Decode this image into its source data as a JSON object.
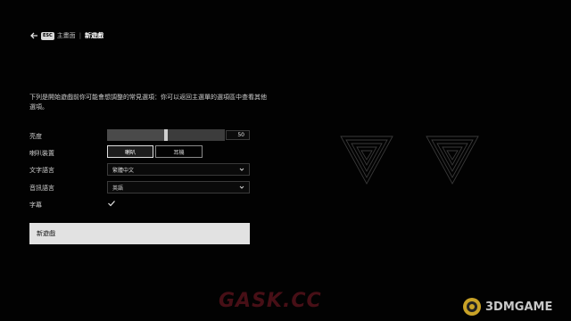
{
  "header": {
    "esc_label": "ESC",
    "breadcrumb_home": "主畫面",
    "breadcrumb_separator": "|",
    "breadcrumb_current": "新遊戲"
  },
  "intro_text": "下列是開始遊戲前你可能會想調整的常見選項：你可以返回主選單的選項區中查看其他選項。",
  "settings": {
    "brightness": {
      "label": "亮度",
      "value": "50",
      "level": 0.5
    },
    "audio_device": {
      "label": "喇叭裝置",
      "options": [
        "喇叭",
        "耳機"
      ],
      "selected": "喇叭"
    },
    "text_language": {
      "label": "文字語言",
      "value": "繁體中文"
    },
    "audio_language": {
      "label": "音訊語言",
      "value": "英語"
    },
    "subtitles": {
      "label": "字幕",
      "checked": true
    }
  },
  "new_game_button": "新遊戲",
  "watermarks": {
    "left": "GASK.CC",
    "right": "3DMGAME"
  },
  "colors": {
    "background": "#020202",
    "button_bg": "#e2e2e2",
    "text": "#d8d8d8"
  }
}
